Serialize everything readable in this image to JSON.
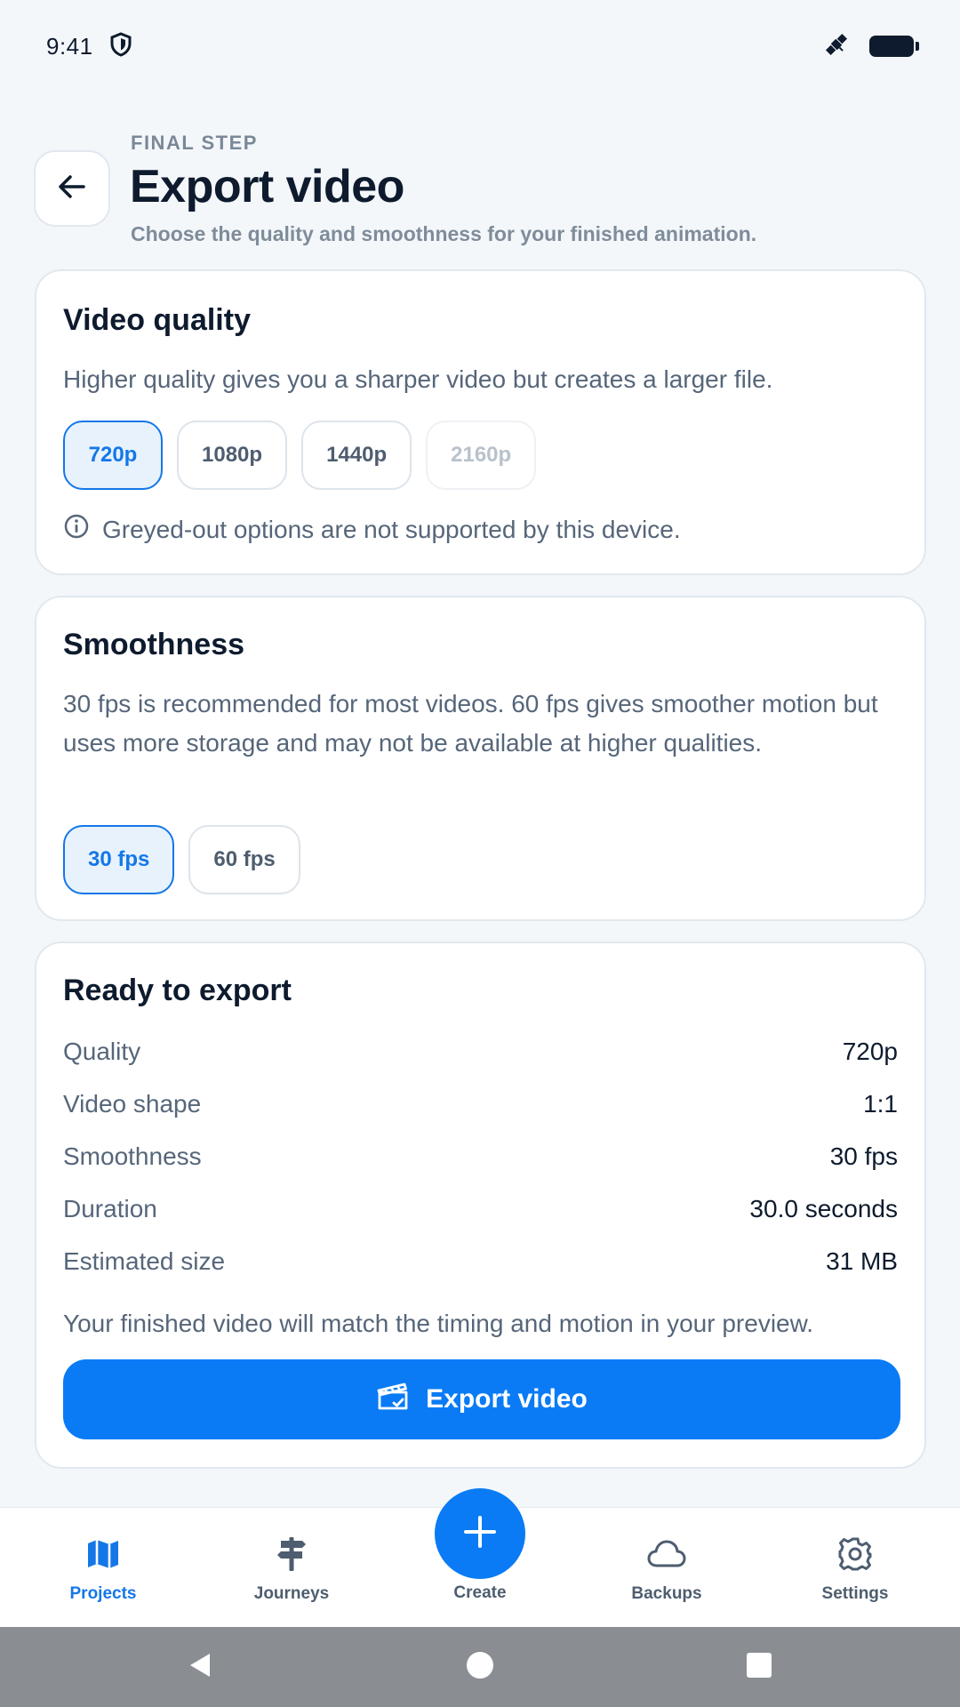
{
  "status_bar": {
    "time": "9:41"
  },
  "header": {
    "eyebrow": "FINAL STEP",
    "title": "Export video",
    "subtitle": "Choose the quality and smoothness for your finished animation."
  },
  "quality_card": {
    "title": "Video quality",
    "description": "Higher quality gives you a sharper video but creates a larger file.",
    "options": [
      {
        "label": "720p",
        "state": "selected"
      },
      {
        "label": "1080p",
        "state": "default"
      },
      {
        "label": "1440p",
        "state": "default"
      },
      {
        "label": "2160p",
        "state": "disabled"
      }
    ],
    "note": "Greyed-out options are not supported by this device."
  },
  "smoothness_card": {
    "title": "Smoothness",
    "description": "30 fps is recommended for most videos. 60 fps gives smoother motion but uses more storage and may not be available at higher qualities.",
    "options": [
      {
        "label": "30 fps",
        "state": "selected"
      },
      {
        "label": "60 fps",
        "state": "default"
      }
    ]
  },
  "summary_card": {
    "title": "Ready to export",
    "rows": [
      {
        "label": "Quality",
        "value": "720p"
      },
      {
        "label": "Video shape",
        "value": "1:1"
      },
      {
        "label": "Smoothness",
        "value": "30 fps"
      },
      {
        "label": "Duration",
        "value": "30.0 seconds"
      },
      {
        "label": "Estimated size",
        "value": "31 MB"
      }
    ],
    "note": "Your finished video will match the timing and motion in your preview.",
    "export_button_label": "Export video"
  },
  "bottom_nav": {
    "items": [
      {
        "label": "Projects",
        "icon": "map-icon",
        "active": true
      },
      {
        "label": "Journeys",
        "icon": "signpost-icon",
        "active": false
      },
      {
        "label": "Create",
        "icon": "plus-icon",
        "active": false
      },
      {
        "label": "Backups",
        "icon": "cloud-icon",
        "active": false
      },
      {
        "label": "Settings",
        "icon": "gear-icon",
        "active": false
      }
    ]
  },
  "colors": {
    "accent": "#0A7BF5",
    "selected_chip_bg": "#E7F2FD",
    "background": "#F4F7FA",
    "title_text": "#0E1B2E",
    "body_text": "#56667A",
    "system_nav": "#8A8E93"
  }
}
